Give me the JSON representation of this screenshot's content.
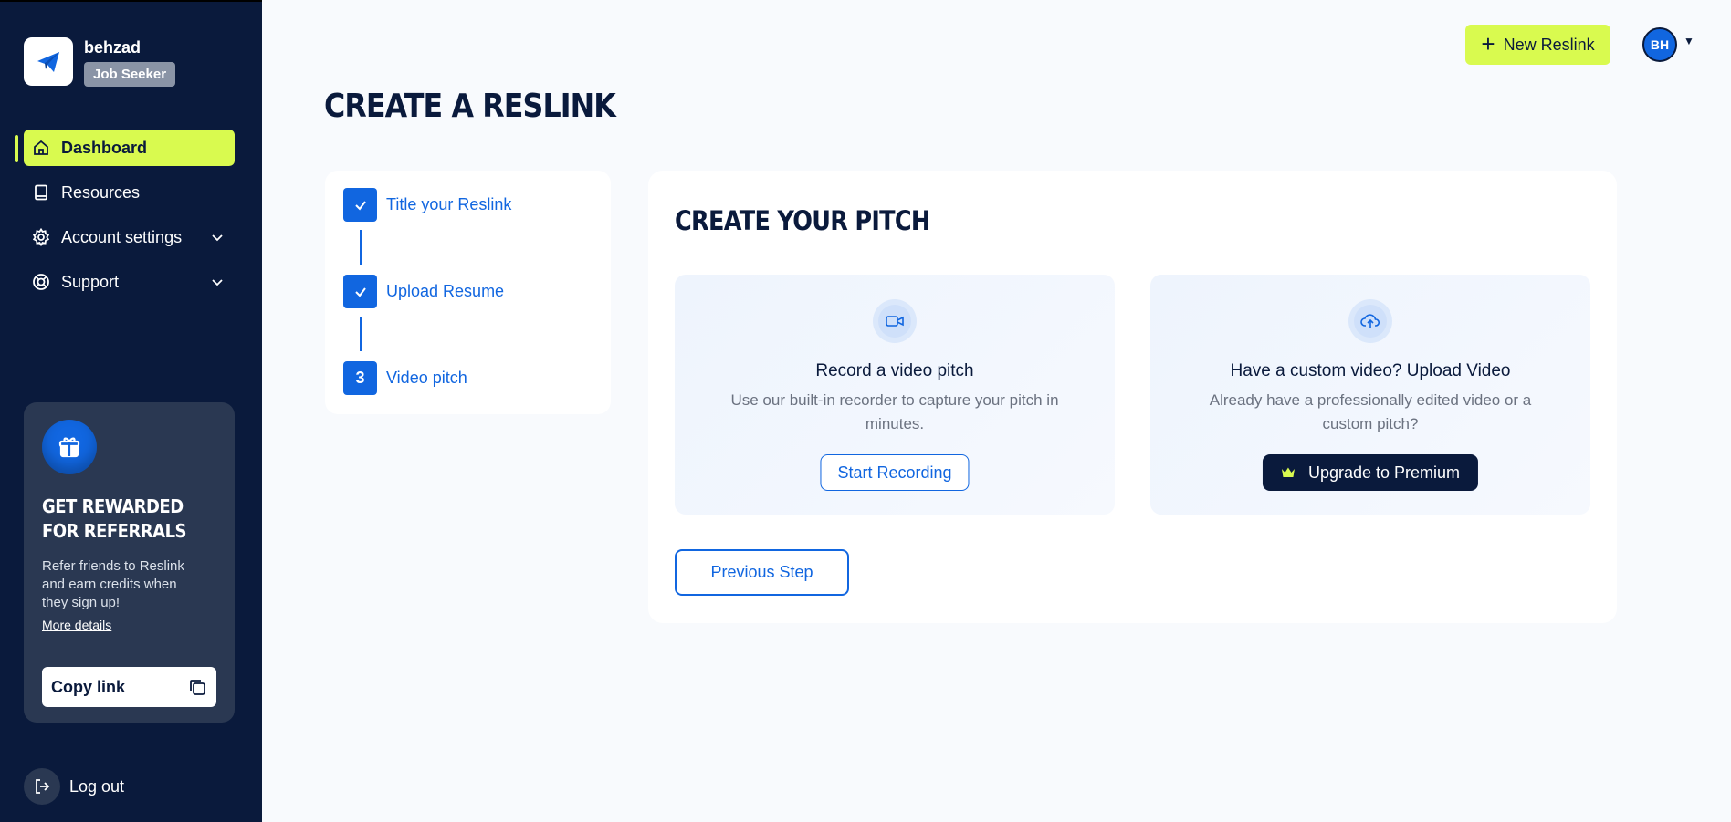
{
  "user": {
    "name": "behzad",
    "role": "Job Seeker",
    "initials": "BH"
  },
  "nav": {
    "dashboard": "Dashboard",
    "resources": "Resources",
    "account_settings": "Account settings",
    "support": "Support"
  },
  "promo": {
    "title": "GET REWARDED FOR REFERRALS",
    "text": "Refer friends to Reslink and earn credits when they sign up!",
    "link": "More details",
    "copy_label": "Copy link"
  },
  "logout_label": "Log out",
  "header": {
    "new_button": "New Reslink"
  },
  "page_title": "CREATE A RESLINK",
  "steps": [
    {
      "label": "Title your Reslink",
      "state": "done"
    },
    {
      "label": "Upload Resume",
      "state": "done"
    },
    {
      "label": "Video pitch",
      "state": "current",
      "number": "3"
    }
  ],
  "pitch": {
    "title": "CREATE YOUR PITCH",
    "record": {
      "title": "Record a video pitch",
      "desc": "Use our built-in recorder to capture your pitch in minutes.",
      "button": "Start Recording"
    },
    "upload": {
      "title": "Have a custom video? Upload Video",
      "desc": "Already have a professionally edited video or a custom pitch?",
      "button": "Upgrade to Premium"
    },
    "previous": "Previous Step"
  },
  "colors": {
    "sidebar": "#0a1a3c",
    "accent": "#d9fa4f",
    "primary": "#1166e0"
  }
}
